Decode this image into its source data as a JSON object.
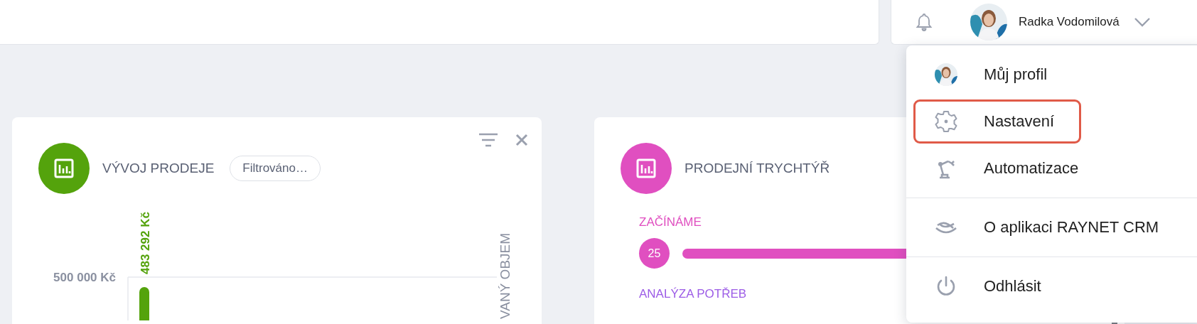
{
  "header": {
    "user": {
      "name": "Radka Vodomilová"
    }
  },
  "widgets": [
    {
      "kind": "chart",
      "title": "VÝVOJ PRODEJE",
      "color": "#54a30c",
      "filter_badge": "Filtrováno…",
      "gridline_label": "500 000 Kč",
      "bar_label": "483 292 Kč",
      "side_caption": "VANÝ OBJEM"
    },
    {
      "kind": "funnel",
      "title": "PRODEJNÍ TRYCHTÝŘ",
      "color": "#e04fc0",
      "stages": [
        {
          "label": "ZAČÍNÁME",
          "count": "25",
          "color": "#e04fc0"
        },
        {
          "label": "ANALÝZA POTŘEB",
          "color": "#9c5ce6"
        }
      ]
    }
  ],
  "user_menu": {
    "sections": [
      [
        {
          "kind": "avatar",
          "label": "Můj profil",
          "highlighted": false
        },
        {
          "kind": "gear",
          "label": "Nastavení",
          "highlighted": true
        },
        {
          "kind": "robot",
          "label": "Automatizace",
          "highlighted": false
        }
      ],
      [
        {
          "kind": "logo",
          "label": "O aplikaci RAYNET CRM",
          "highlighted": false
        }
      ],
      [
        {
          "kind": "power",
          "label": "Odhlásit",
          "highlighted": false
        }
      ]
    ]
  }
}
